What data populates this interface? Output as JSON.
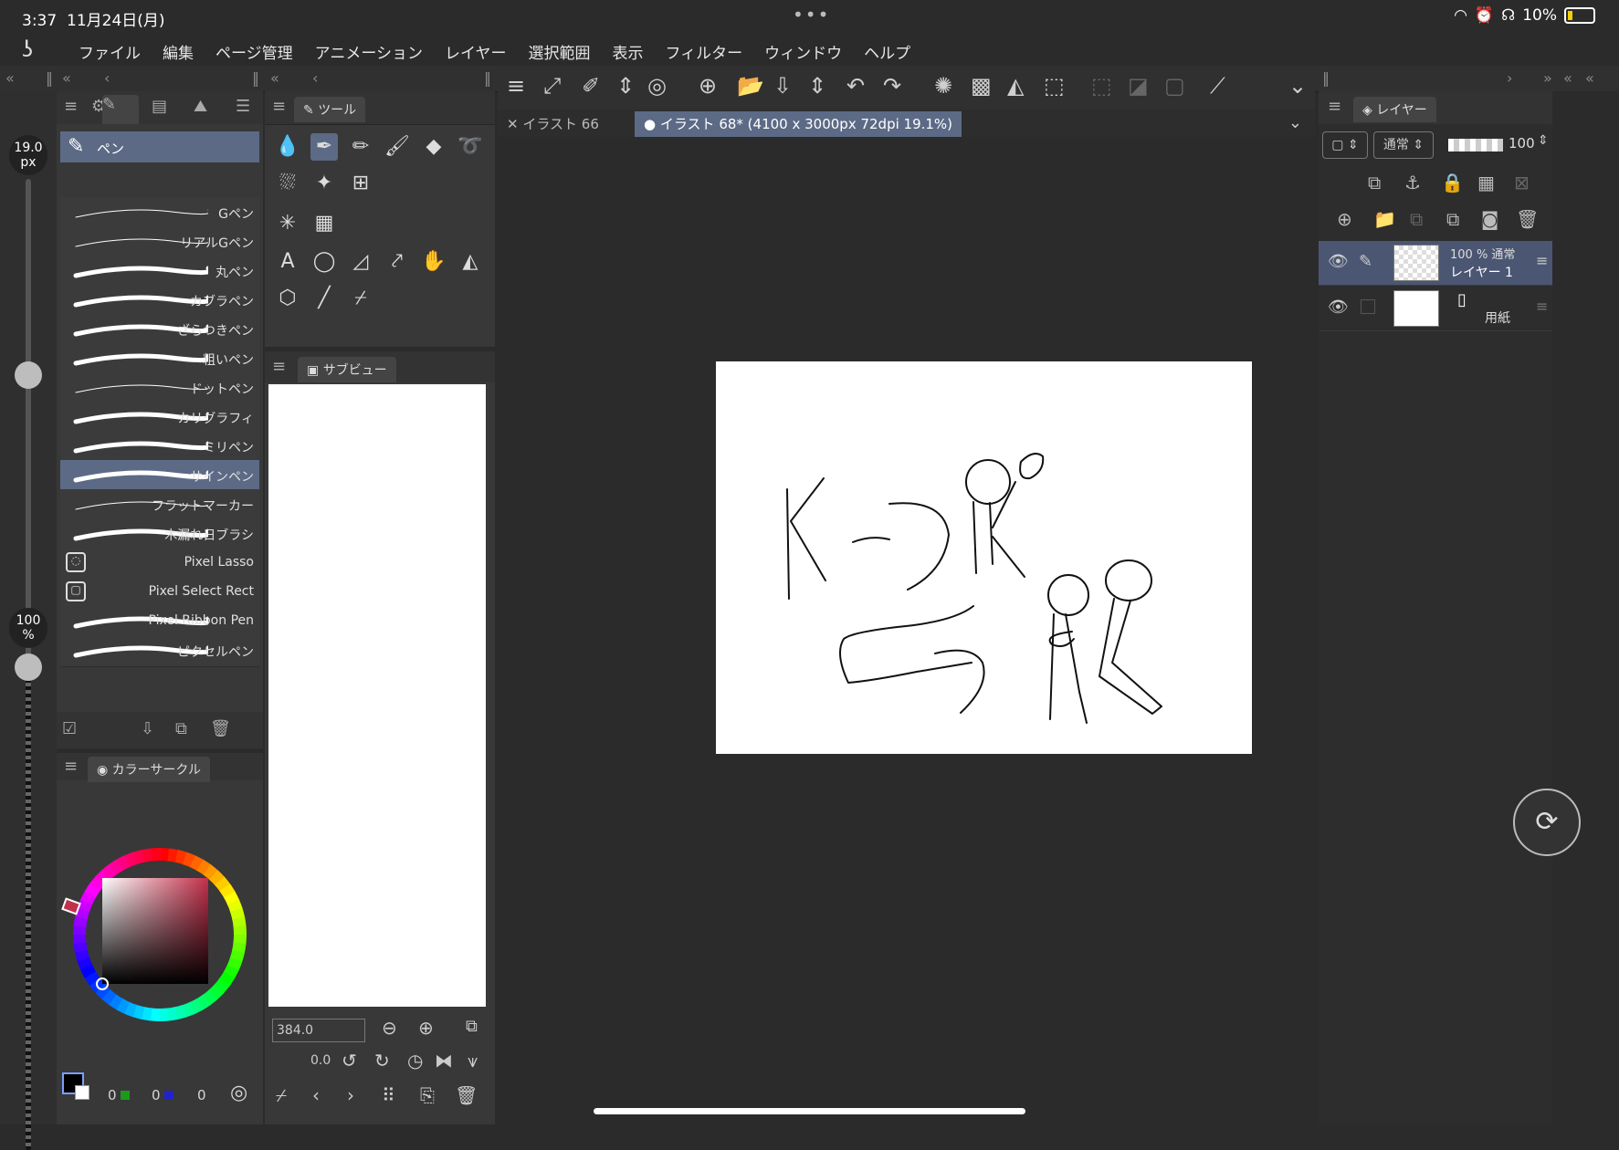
{
  "status_bar": {
    "time": "3:37",
    "date": "11月24日(月)",
    "battery_text": "10%"
  },
  "menu": {
    "items": [
      "ファイル",
      "編集",
      "ページ管理",
      "アニメーション",
      "レイヤー",
      "選択範囲",
      "表示",
      "フィルター",
      "ウィンドウ",
      "ヘルプ"
    ]
  },
  "brush_size": {
    "value": "19.0",
    "unit": "px",
    "opacity_value": "100",
    "opacity_unit": "%"
  },
  "brush_panel": {
    "header": "ペン",
    "items": [
      "Gペン",
      "リアルGペン",
      "丸ペン",
      "カブラペン",
      "ざらつきペン",
      "粗いペン",
      "ドットペン",
      "カリグラフィ",
      "ミリペン",
      "サインペン",
      "フラットマーカー",
      "木漏れ日ブラシ",
      "Pixel Lasso",
      "Pixel Select Rect",
      "Pixel Ribbon Pen",
      "ピクセルペン"
    ],
    "selected_index": 9
  },
  "tool_panel": {
    "tab_label": "ツール"
  },
  "sub_view": {
    "tab_label": "サブビュー",
    "zoom": "384.0",
    "rotation": "0.0"
  },
  "color_panel": {
    "tab_label": "カラーサークル",
    "r": "0",
    "g": "0",
    "b": "0",
    "accent_color": "#c3304a"
  },
  "doc_tabs": {
    "tab1": "イラスト 66",
    "tab2": "イラスト 68* (4100 x 3000px 72dpi 19.1%)"
  },
  "layer_panel": {
    "tab_label": "レイヤー",
    "blend_mode": "通常",
    "opacity": "100",
    "layers": [
      {
        "opacity_mode": "100 % 通常",
        "name": "レイヤー 1"
      },
      {
        "name": "用紙"
      }
    ]
  },
  "colors": {
    "accent": "#5c6a86",
    "panel_bg": "#383838"
  }
}
